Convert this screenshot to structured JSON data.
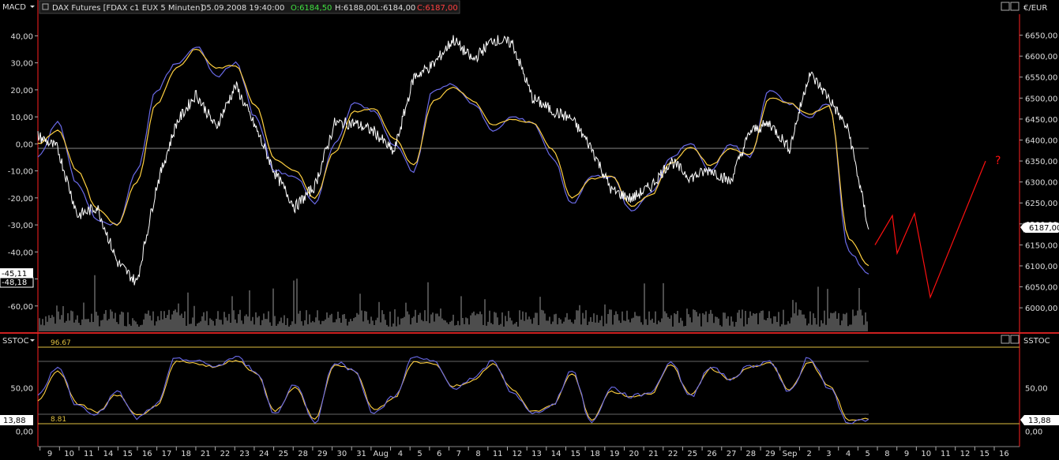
{
  "header": {
    "panel_main": "MACD",
    "title": "DAX Futures [FDAX c1 EUX  5 Minuten]",
    "datetime": "05.09.2008 19:40:00",
    "open": "O:6184,50",
    "high": "H:6188,00",
    "low": "L:6184,00",
    "close": "C:6187,00",
    "unit": "€/EUR",
    "panel_lower": "SSTOC"
  },
  "badges": {
    "last_price": "6187,00",
    "macd_a": "-45,11",
    "macd_b": "-48,18",
    "stoch_left": "13,88",
    "stoch_right": "13,88"
  },
  "annotation": "?",
  "colors": {
    "background": "#000000",
    "price": "#ffffff",
    "signal": "#ffd040",
    "macd": "#6a6ae8",
    "forecast": "#ff1010",
    "frame_red": "#cc2020",
    "level_line": "#e0c040"
  },
  "chart_data": [
    {
      "type": "line",
      "title": "DAX Futures [FDAX c1 EUX  5 Minuten]",
      "ylabel_right": "€/EUR",
      "ylim_price": [
        5940,
        6700
      ],
      "ylim_macd": [
        -70,
        48
      ],
      "price_ticks": [
        "6000,00",
        "6050,00",
        "6100,00",
        "6150,00",
        "6200,00",
        "6250,00",
        "6300,00",
        "6350,00",
        "6400,00",
        "6450,00",
        "6500,00",
        "6550,00",
        "6600,00",
        "6650,00"
      ],
      "macd_ticks": [
        "-60,00",
        "-50,00",
        "-40,00",
        "-30,00",
        "-20,00",
        "-10,00",
        "0,00",
        "10,00",
        "20,00",
        "30,00",
        "40,00"
      ],
      "x_labels": [
        "9",
        "10",
        "11",
        "14",
        "15",
        "16",
        "17",
        "18",
        "21",
        "22",
        "23",
        "24",
        "25",
        "28",
        "29",
        "30",
        "31",
        "Aug",
        "4",
        "5",
        "6",
        "7",
        "8",
        "11",
        "12",
        "13",
        "14",
        "15",
        "18",
        "19",
        "20",
        "21",
        "22",
        "25",
        "26",
        "27",
        "28",
        "29",
        "Sep",
        "2",
        "3",
        "4",
        "5",
        "8",
        "9",
        "10",
        "11",
        "12",
        "15",
        "16"
      ],
      "price_close_by_day": [
        6410,
        6380,
        6220,
        6240,
        6110,
        6060,
        6290,
        6440,
        6510,
        6430,
        6530,
        6430,
        6320,
        6240,
        6290,
        6440,
        6440,
        6420,
        6370,
        6550,
        6580,
        6640,
        6590,
        6640,
        6630,
        6500,
        6470,
        6450,
        6380,
        6280,
        6260,
        6290,
        6350,
        6310,
        6330,
        6300,
        6420,
        6440,
        6380,
        6560,
        6500,
        6420,
        6187
      ],
      "macd_by_day": [
        -5,
        8,
        -15,
        -28,
        -30,
        -10,
        20,
        30,
        36,
        25,
        30,
        10,
        -10,
        -12,
        -22,
        0,
        15,
        12,
        0,
        -10,
        20,
        22,
        15,
        5,
        10,
        8,
        -5,
        -22,
        -12,
        -12,
        -25,
        -18,
        -5,
        0,
        -10,
        0,
        -5,
        20,
        15,
        10,
        15,
        -40,
        -48.18
      ],
      "signal_by_day": [
        0,
        5,
        -10,
        -24,
        -30,
        -14,
        15,
        28,
        35,
        28,
        29,
        14,
        -6,
        -10,
        -20,
        -3,
        12,
        13,
        2,
        -8,
        16,
        21,
        16,
        7,
        9,
        8,
        -2,
        -20,
        -13,
        -12,
        -23,
        -19,
        -7,
        -1,
        -8,
        -2,
        -4,
        17,
        15,
        11,
        14,
        -35,
        -45.11
      ],
      "forecast_price": [
        6150,
        6220,
        6130,
        6225,
        6025,
        6350
      ]
    },
    {
      "type": "line",
      "title": "SSTOC",
      "ylim": [
        -10,
        110
      ],
      "y_ticks": [
        "0,00",
        "50,00"
      ],
      "levels": [
        "96.67",
        "8.81"
      ],
      "k_by_day": [
        40,
        75,
        30,
        20,
        45,
        15,
        30,
        85,
        80,
        75,
        85,
        70,
        20,
        55,
        10,
        80,
        70,
        20,
        40,
        85,
        80,
        50,
        60,
        80,
        45,
        20,
        30,
        70,
        10,
        50,
        40,
        45,
        80,
        40,
        75,
        60,
        75,
        80,
        45,
        85,
        50,
        10,
        13.88
      ],
      "d_by_day": [
        35,
        70,
        32,
        22,
        42,
        18,
        28,
        80,
        78,
        74,
        82,
        68,
        24,
        50,
        14,
        76,
        70,
        24,
        38,
        80,
        78,
        52,
        58,
        78,
        48,
        22,
        30,
        66,
        14,
        46,
        40,
        44,
        76,
        42,
        72,
        60,
        74,
        78,
        48,
        80,
        52,
        14,
        13.88
      ]
    }
  ]
}
